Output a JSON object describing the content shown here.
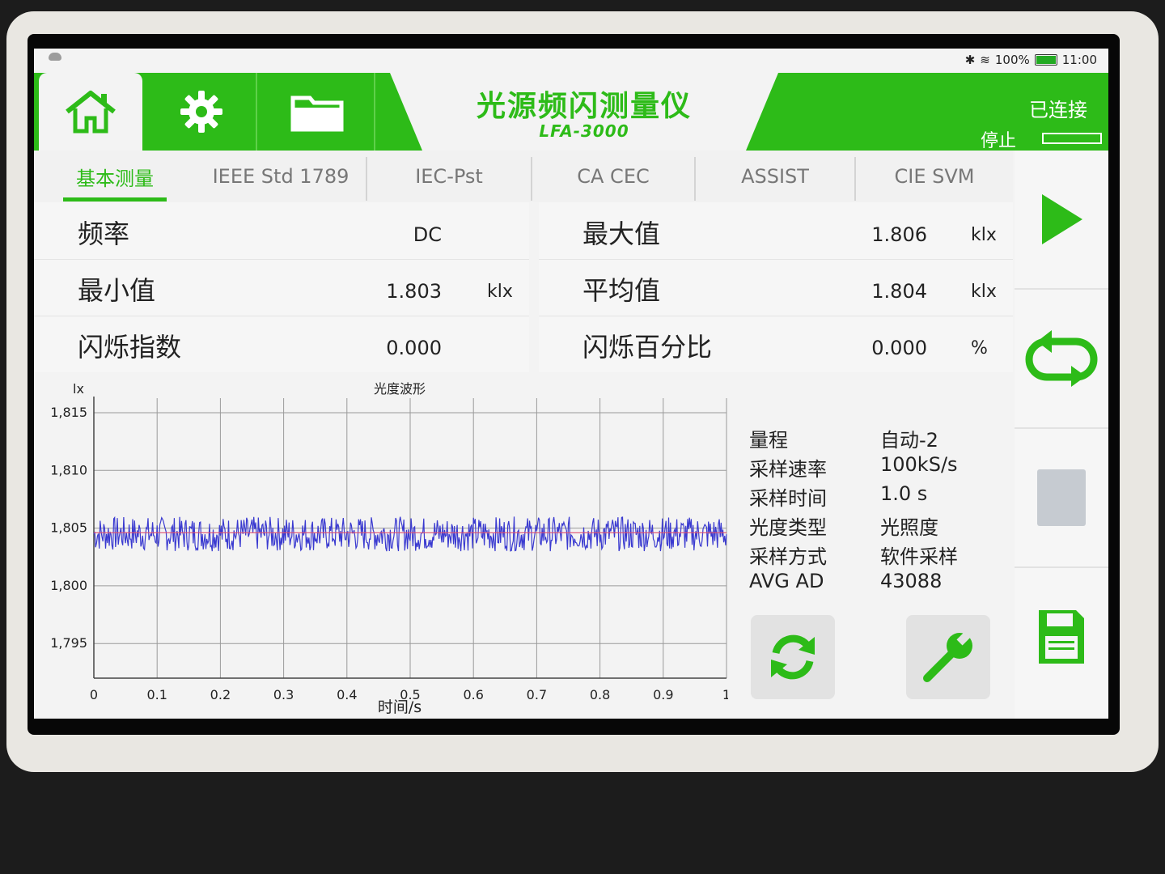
{
  "status": {
    "battery": "100%",
    "time": "11:00"
  },
  "header": {
    "title": "光源频闪测量仪",
    "model": "LFA-3000",
    "connection": "已连接",
    "stop_label": "停止",
    "icons": {
      "home": "home-icon",
      "settings": "gear-icon",
      "files": "folder-icon"
    }
  },
  "tabs": [
    {
      "label": "基本测量",
      "active": true
    },
    {
      "label": "IEEE Std 1789",
      "active": false
    },
    {
      "label": "IEC-Pst",
      "active": false
    },
    {
      "label": "CA CEC",
      "active": false
    },
    {
      "label": "ASSIST",
      "active": false
    },
    {
      "label": "CIE SVM",
      "active": false
    }
  ],
  "measurements": {
    "left": [
      {
        "label": "频率",
        "value": "DC",
        "unit": ""
      },
      {
        "label": "最小值",
        "value": "1.803",
        "unit": "klx"
      },
      {
        "label": "闪烁指数",
        "value": "0.000",
        "unit": ""
      }
    ],
    "right": [
      {
        "label": "最大值",
        "value": "1.806",
        "unit": "klx"
      },
      {
        "label": "平均值",
        "value": "1.804",
        "unit": "klx"
      },
      {
        "label": "闪烁百分比",
        "value": "0.000",
        "unit": "%"
      }
    ]
  },
  "chart_data": {
    "type": "line",
    "title": "光度波形",
    "xlabel": "时间/s",
    "ylabel": "lx",
    "xlim": [
      0,
      1
    ],
    "ylim": [
      1792,
      1815
    ],
    "x_ticks": [
      "0",
      "0.1",
      "0.2",
      "0.3",
      "0.4",
      "0.5",
      "0.6",
      "0.7",
      "0.8",
      "0.9",
      "1"
    ],
    "y_ticks": [
      "1,815",
      "1,810",
      "1,805",
      "1,800",
      "1,795"
    ],
    "series": [
      {
        "color": "#3a3ad0",
        "mean": 1804.4,
        "min": 1803,
        "max": 1806
      },
      {
        "color": "#e05070",
        "constant": 1804.6
      }
    ],
    "grid": true
  },
  "info_panel": [
    {
      "key": "量程",
      "value": "自动-2"
    },
    {
      "key": "采样速率",
      "value": "100kS/s"
    },
    {
      "key": "采样时间",
      "value": "1.0 s"
    },
    {
      "key": "光度类型",
      "value": "光照度"
    },
    {
      "key": "采样方式",
      "value": "软件采样"
    },
    {
      "key": "AVG AD",
      "value": "43088"
    }
  ],
  "tools": {
    "refresh_icon": "refresh-icon",
    "wrench_icon": "wrench-icon"
  },
  "sidebar": {
    "play_icon": "play-icon",
    "loop_icon": "loop-icon",
    "save_icon": "save-icon"
  },
  "colors": {
    "brand_green": "#2dbb18",
    "trace_blue": "#3a3ad0",
    "mean_line": "#e05070"
  }
}
